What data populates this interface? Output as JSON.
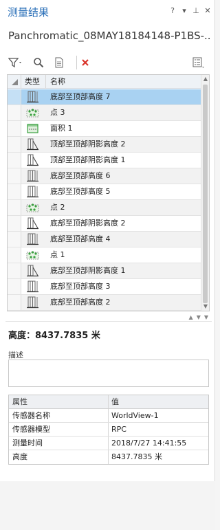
{
  "pane": {
    "title": "测量结果",
    "controls": [
      "?",
      "▾",
      "⊥",
      "✕"
    ],
    "subtitle": "Panchromatic_08MAY18184148-P1BS-..."
  },
  "colors": {
    "title": "#2a6fb8",
    "selected_row": "#a9d2f2",
    "delete_icon": "#d9342b",
    "icon_green": "#3aa13f",
    "icon_gray": "#666666"
  },
  "toolbar": {
    "icons": [
      "filter-icon",
      "zoom-to-icon",
      "export-icon",
      "delete-icon",
      "column-options-icon"
    ]
  },
  "grid": {
    "headers": {
      "type": "类型",
      "name": "名称"
    },
    "rows": [
      {
        "icon": "height-base-icon",
        "name": "底部至顶部高度 7",
        "selected": true
      },
      {
        "icon": "point-icon",
        "name": "点 3"
      },
      {
        "icon": "area-icon",
        "name": "面积 1"
      },
      {
        "icon": "shadow-height-icon",
        "name": "顶部至顶部阴影高度 2"
      },
      {
        "icon": "shadow-height-icon",
        "name": "顶部至顶部阴影高度 1"
      },
      {
        "icon": "height-base-icon",
        "name": "底部至顶部高度 6"
      },
      {
        "icon": "height-base-icon",
        "name": "底部至顶部高度 5"
      },
      {
        "icon": "point-icon",
        "name": "点 2"
      },
      {
        "icon": "shadow-height-icon",
        "name": "底部至顶部阴影高度 2"
      },
      {
        "icon": "height-base-icon",
        "name": "底部至顶部高度 4"
      },
      {
        "icon": "point-icon",
        "name": "点 1"
      },
      {
        "icon": "shadow-height-icon",
        "name": "底部至顶部阴影高度 1"
      },
      {
        "icon": "height-base-icon",
        "name": "底部至顶部高度 3"
      },
      {
        "icon": "height-base-icon",
        "name": "底部至顶部高度 2"
      }
    ]
  },
  "detail": {
    "height_line": "高度：8437.7835 米",
    "description_label": "描述",
    "description_value": "",
    "table_headers": {
      "attribute": "属性",
      "value": "值"
    },
    "table_rows": [
      {
        "attribute": "传感器名称",
        "value": "WorldView-1"
      },
      {
        "attribute": "传感器模型",
        "value": "RPC"
      },
      {
        "attribute": "测量时间",
        "value": "2018/7/27 14:41:55"
      },
      {
        "attribute": "高度",
        "value": "8437.7835 米"
      }
    ]
  }
}
